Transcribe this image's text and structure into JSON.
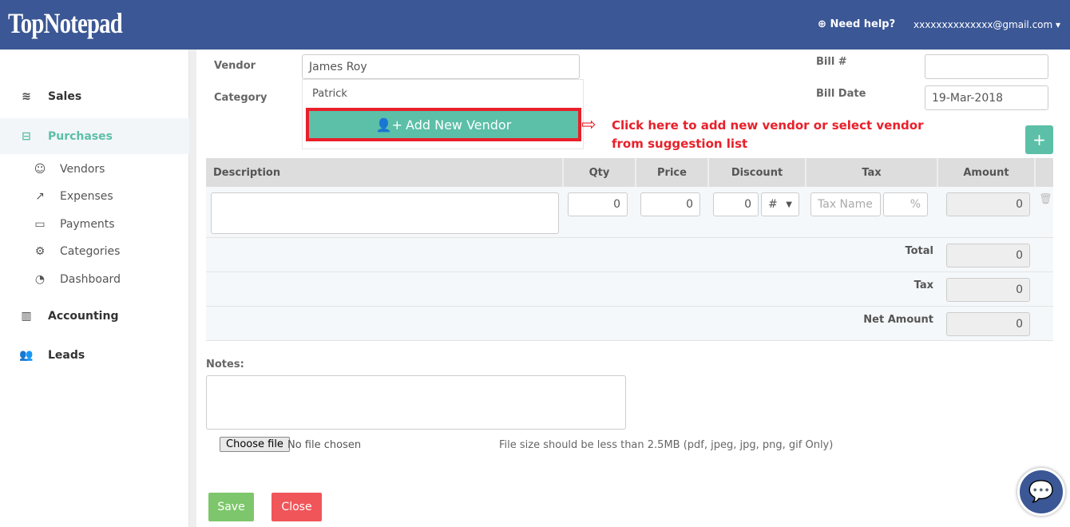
{
  "header": {
    "logo": "TopNotepad",
    "help": "Need help?",
    "email": "xxxxxxxxxxxxxx@gmail.com"
  },
  "sidebar": {
    "items": [
      {
        "label": "Sales",
        "icon": "layers-icon"
      },
      {
        "label": "Purchases",
        "icon": "minus-square-icon",
        "active": true
      },
      {
        "label": "Accounting",
        "icon": "bar-chart-icon"
      },
      {
        "label": "Leads",
        "icon": "users-icon"
      }
    ],
    "subitems": [
      {
        "label": "Vendors",
        "icon": "user-icon"
      },
      {
        "label": "Expenses",
        "icon": "share-icon"
      },
      {
        "label": "Payments",
        "icon": "credit-card-icon"
      },
      {
        "label": "Categories",
        "icon": "gear-icon"
      },
      {
        "label": "Dashboard",
        "icon": "dashboard-icon"
      }
    ]
  },
  "form": {
    "vendor_label": "Vendor",
    "vendor_value": "James Roy",
    "category_label": "Category",
    "suggestion": "Patrick",
    "add_vendor": "Add New Vendor",
    "bill_no_label": "Bill #",
    "bill_no_value": "",
    "bill_date_label": "Bill Date",
    "bill_date_value": "19-Mar-2018"
  },
  "annotation": "Click here to add new vendor or select vendor from suggestion list",
  "table": {
    "columns": [
      "Description",
      "Qty",
      "Price",
      "Discount",
      "Tax",
      "Amount"
    ],
    "row": {
      "description": "",
      "qty": "0",
      "price": "0",
      "discount": "0",
      "discount_type": "#",
      "tax_name_placeholder": "Tax Name",
      "tax_pct_placeholder": "%",
      "amount": "0"
    },
    "totals": [
      {
        "label": "Total",
        "value": "0"
      },
      {
        "label": "Tax",
        "value": "0"
      },
      {
        "label": "Net Amount",
        "value": "0"
      }
    ]
  },
  "notes": {
    "label": "Notes:",
    "value": ""
  },
  "file": {
    "button": "Choose file",
    "status": "No file chosen",
    "hint": "File size should be less than 2.5MB (pdf, jpeg, jpg, png, gif Only)"
  },
  "actions": {
    "save": "Save",
    "close": "Close"
  },
  "colors": {
    "header": "#3b5795",
    "accent": "#5cbfa8",
    "annotation": "#e8202a",
    "save": "#7dc66b",
    "close": "#f05559"
  }
}
